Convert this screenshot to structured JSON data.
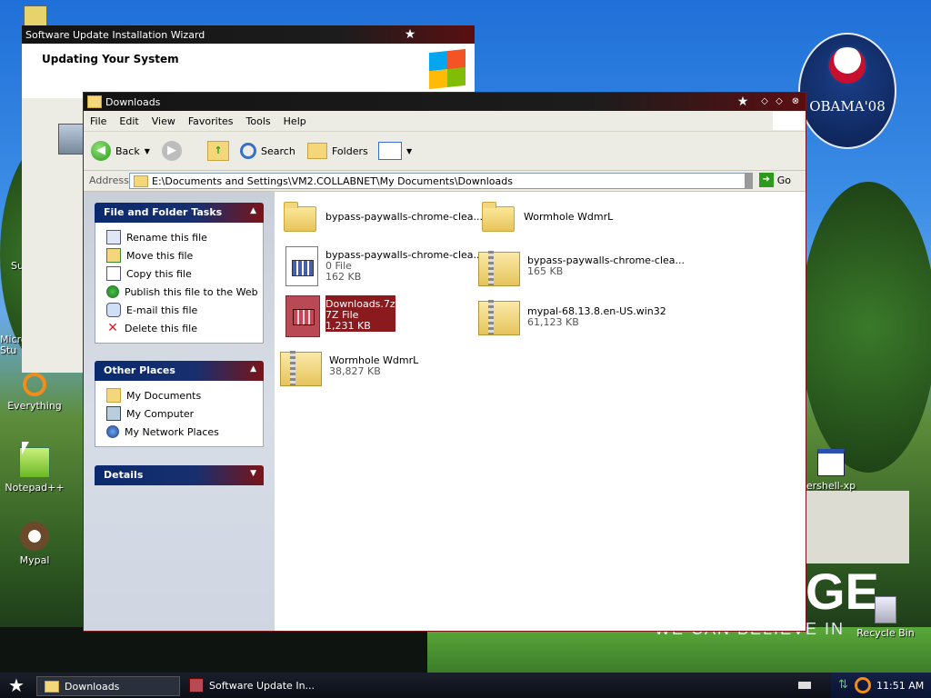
{
  "desktop": {
    "badge_text": "OBAMA'08",
    "slogan_big": "GE",
    "slogan_small": "WE CAN BELIEVE IN",
    "icons": [
      {
        "label": "Everything"
      },
      {
        "label": "Notepad++"
      },
      {
        "label": "Mypal"
      },
      {
        "label": "Recycle Bin"
      },
      {
        "label": "ershell-xp"
      },
      {
        "label": "Micro Stu"
      },
      {
        "label": "Su"
      }
    ]
  },
  "wizard": {
    "title": "Software Update Installation Wizard",
    "heading": "Updating Your System"
  },
  "explorer": {
    "title": "Downloads",
    "menu": [
      "File",
      "Edit",
      "View",
      "Favorites",
      "Tools",
      "Help"
    ],
    "toolbar": {
      "back": "Back",
      "search": "Search",
      "folders": "Folders"
    },
    "address_label": "Address",
    "address_value": "E:\\Documents and Settings\\VM2.COLLABNET\\My Documents\\Downloads",
    "go_label": "Go",
    "file_tasks": {
      "title": "File and Folder Tasks",
      "items": [
        "Rename this file",
        "Move this file",
        "Copy this file",
        "Publish this file to the Web",
        "E-mail this file",
        "Delete this file"
      ]
    },
    "other_places": {
      "title": "Other Places",
      "items": [
        "My Documents",
        "My Computer",
        "My Network Places"
      ]
    },
    "details": {
      "title": "Details"
    },
    "files": [
      {
        "name": "bypass-paywalls-chrome-clea...",
        "kind": "folder"
      },
      {
        "name": "Wormhole WdmrL",
        "kind": "folder"
      },
      {
        "name": "bypass-paywalls-chrome-clea...",
        "type": "0 File",
        "size": "162 KB",
        "kind": "doc"
      },
      {
        "name": "bypass-paywalls-chrome-clea...",
        "size": "165 KB",
        "kind": "zip"
      },
      {
        "name": "Downloads.7z",
        "type": "7Z File",
        "size": "1,231 KB",
        "kind": "7z",
        "selected": true
      },
      {
        "name": "mypal-68.13.8.en-US.win32",
        "size": "61,123 KB",
        "kind": "zip"
      },
      {
        "name": "Wormhole WdmrL",
        "size": "38,827 KB",
        "kind": "zip"
      }
    ]
  },
  "taskbar": {
    "tasks": [
      {
        "label": "Downloads"
      },
      {
        "label": "Software Update In..."
      }
    ],
    "clock": "11:51 AM"
  }
}
